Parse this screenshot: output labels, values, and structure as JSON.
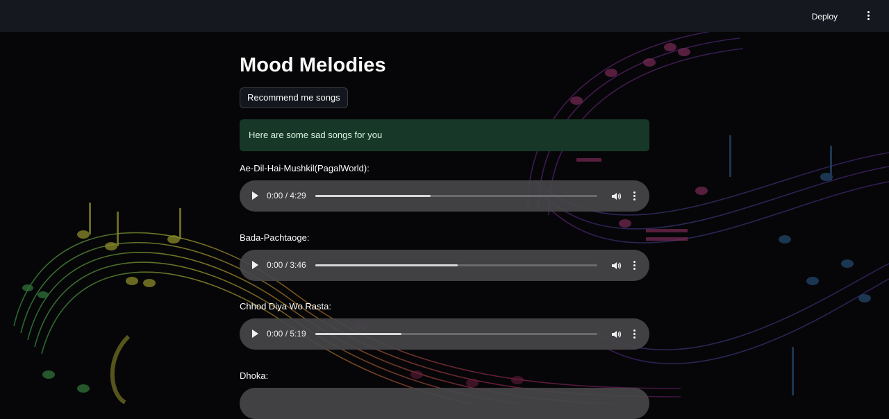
{
  "header": {
    "deploy_label": "Deploy",
    "menu_icon": "vertical-ellipsis-icon"
  },
  "page": {
    "title": "Mood Melodies",
    "recommend_label": "Recommend me songs",
    "alert_text": "Here are some sad songs for you"
  },
  "songs": [
    {
      "label": "Ae-Dil-Hai-Mushkil(PagalWorld):",
      "time": "0:00 / 4:29",
      "buffered": 0.41
    },
    {
      "label": "Bada-Pachtaoge:",
      "time": "0:00 / 3:46",
      "buffered": 0.505
    },
    {
      "label": "Chhod Diya Wo Rasta:",
      "time": "0:00 / 5:19",
      "buffered": 0.305
    },
    {
      "label": "Dhoka:",
      "time": "",
      "buffered": 0
    }
  ],
  "icons": {
    "play": "play-icon",
    "volume": "volume-icon",
    "more": "more-options-icon"
  },
  "colors": {
    "background": "#060608",
    "topbar": "#15181f",
    "alert_bg": "#173828",
    "player_bg": "#46464a"
  }
}
